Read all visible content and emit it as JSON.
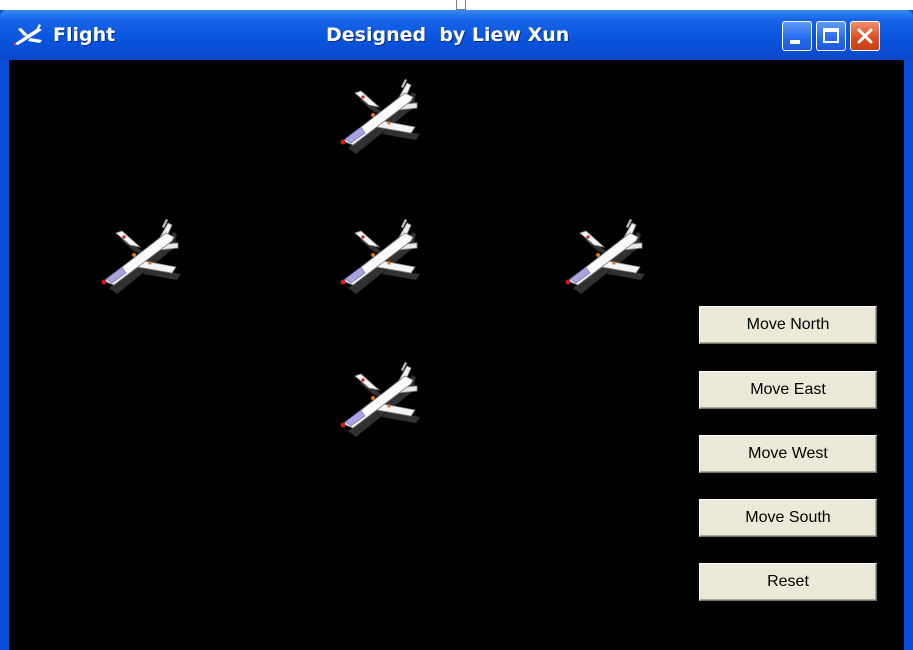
{
  "window": {
    "app_title": "Flight",
    "center_title": "Designed  by Liew Xun",
    "app_icon": "plane-icon",
    "controls": [
      "minimize-icon",
      "maximize-icon",
      "close-icon"
    ]
  },
  "buttons": {
    "north": "Move North",
    "east": "Move East",
    "west": "Move West",
    "south": "Move South",
    "reset": "Reset"
  },
  "sprites": {
    "icon": "airplane-icon",
    "colors": {
      "background": "#000000",
      "titlebar": "#0a4ed6",
      "close_button": "#dd4a1f"
    }
  }
}
